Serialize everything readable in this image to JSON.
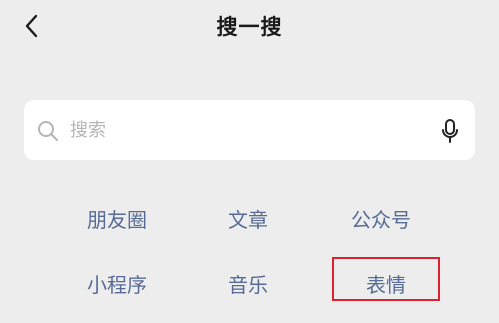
{
  "header": {
    "title": "搜一搜",
    "back_icon": "chevron-left-icon"
  },
  "search": {
    "placeholder": "搜索",
    "search_icon": "search-icon",
    "voice_icon": "microphone-icon"
  },
  "categories": [
    {
      "label": "朋友圈"
    },
    {
      "label": "文章"
    },
    {
      "label": "公众号"
    },
    {
      "label": "小程序"
    },
    {
      "label": "音乐"
    },
    {
      "label": "表情"
    }
  ],
  "colors": {
    "background": "#ededed",
    "link": "#576b95",
    "highlight_border": "#d9232e"
  }
}
